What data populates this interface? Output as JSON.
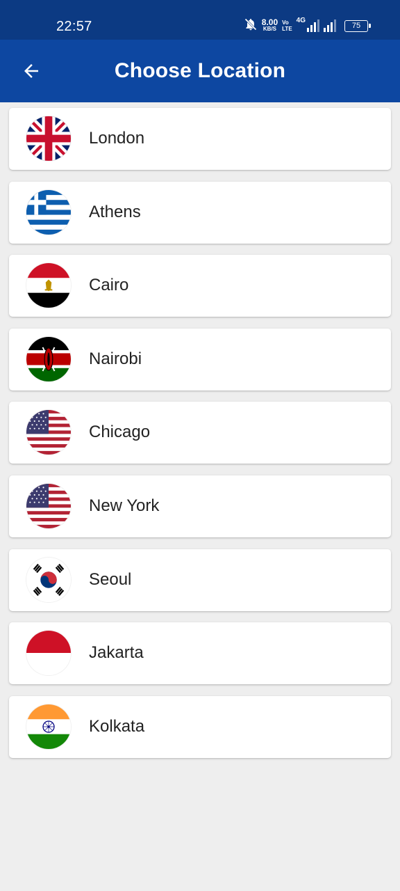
{
  "status_bar": {
    "time": "22:57",
    "net_speed_value": "8.00",
    "net_speed_unit": "KB/S",
    "volte_top": "Vo",
    "volte_bottom": "LTE",
    "network": "4G",
    "battery": "75"
  },
  "app_bar": {
    "title": "Choose Location",
    "back_icon": "arrow-back-icon"
  },
  "locations": [
    {
      "name": "London",
      "flag": "uk-flag-icon"
    },
    {
      "name": "Athens",
      "flag": "greece-flag-icon"
    },
    {
      "name": "Cairo",
      "flag": "egypt-flag-icon"
    },
    {
      "name": "Nairobi",
      "flag": "kenya-flag-icon"
    },
    {
      "name": "Chicago",
      "flag": "usa-flag-icon"
    },
    {
      "name": "New York",
      "flag": "usa-flag-icon"
    },
    {
      "name": "Seoul",
      "flag": "south-korea-flag-icon"
    },
    {
      "name": "Jakarta",
      "flag": "indonesia-flag-icon"
    },
    {
      "name": "Kolkata",
      "flag": "india-flag-icon"
    }
  ],
  "colors": {
    "status_bar": "#0c3a83",
    "app_bar": "#0d47a1",
    "background": "#eeeeee",
    "card": "#ffffff"
  }
}
